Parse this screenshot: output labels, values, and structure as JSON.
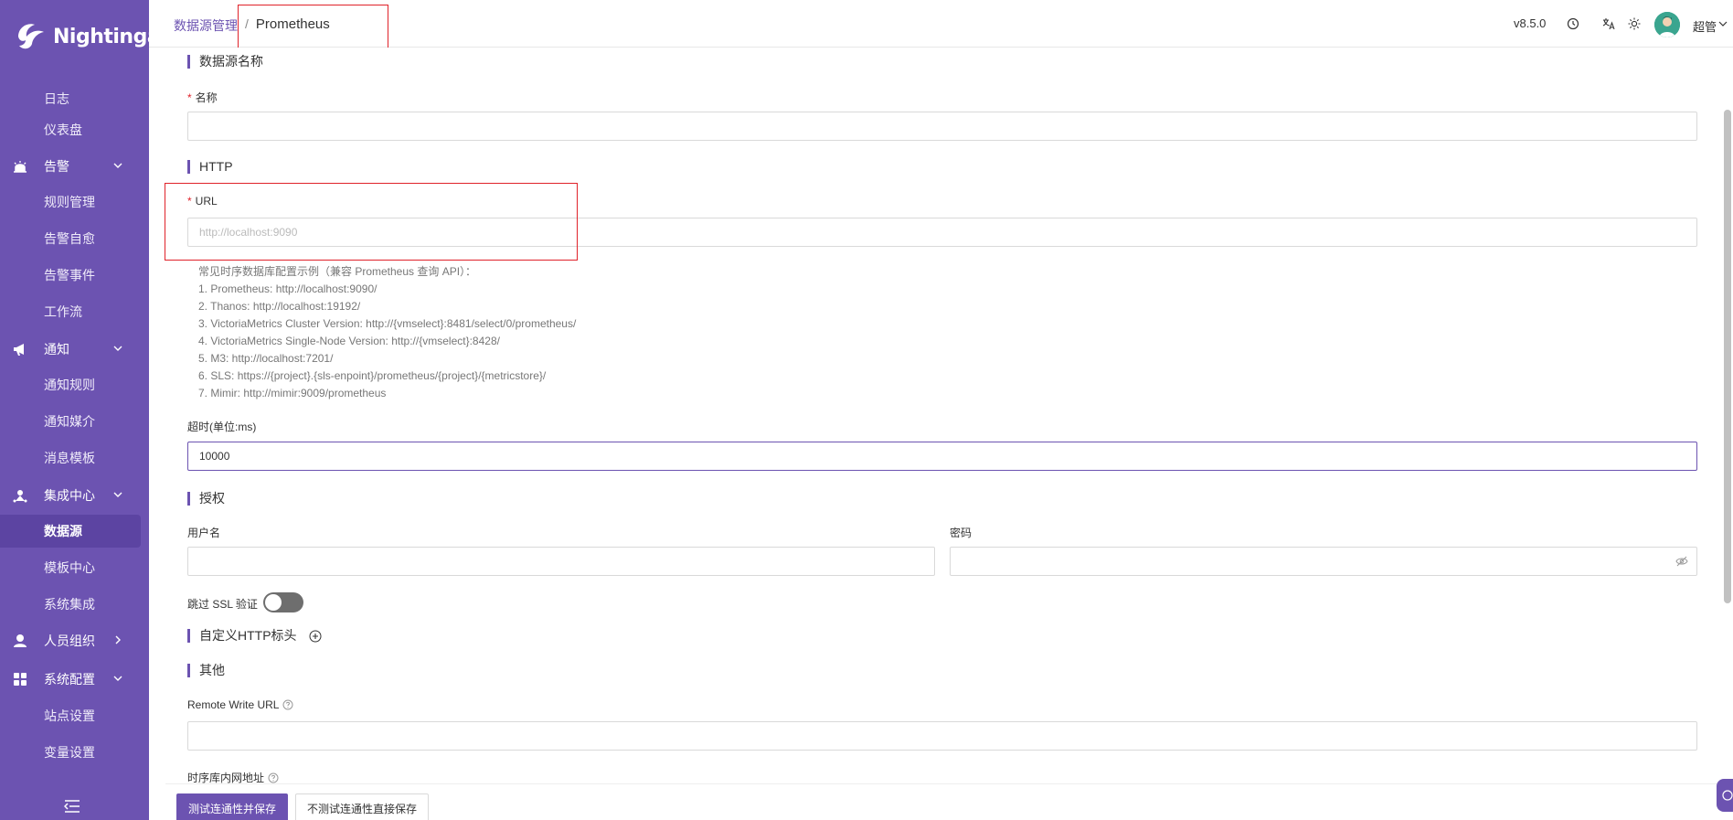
{
  "app": {
    "logo_text": "Nightingale"
  },
  "sidebar": {
    "items": [
      {
        "label": "日志",
        "type": "sub"
      },
      {
        "label": "仪表盘",
        "type": "sub"
      },
      {
        "label": "告警",
        "type": "group",
        "icon": "alarm-icon",
        "chevron": "down"
      },
      {
        "label": "规则管理",
        "type": "sub"
      },
      {
        "label": "告警自愈",
        "type": "sub"
      },
      {
        "label": "告警事件",
        "type": "sub"
      },
      {
        "label": "工作流",
        "type": "sub"
      },
      {
        "label": "通知",
        "type": "group",
        "icon": "megaphone-icon",
        "chevron": "down"
      },
      {
        "label": "通知规则",
        "type": "sub"
      },
      {
        "label": "通知媒介",
        "type": "sub"
      },
      {
        "label": "消息模板",
        "type": "sub"
      },
      {
        "label": "集成中心",
        "type": "group",
        "icon": "integration-icon",
        "chevron": "down"
      },
      {
        "label": "数据源",
        "type": "sub",
        "active": true
      },
      {
        "label": "模板中心",
        "type": "sub"
      },
      {
        "label": "系统集成",
        "type": "sub"
      },
      {
        "label": "人员组织",
        "type": "group",
        "icon": "user-icon",
        "chevron": "right"
      },
      {
        "label": "系统配置",
        "type": "group",
        "icon": "grid-icon",
        "chevron": "down"
      },
      {
        "label": "站点设置",
        "type": "sub"
      },
      {
        "label": "变量设置",
        "type": "sub"
      }
    ]
  },
  "header": {
    "breadcrumb_parent": "数据源管理",
    "breadcrumb_sep": "/",
    "breadcrumb_current": "Prometheus",
    "version": "v8.5.0",
    "username": "超管"
  },
  "form": {
    "section_name": "数据源名称",
    "name_label": "名称",
    "name_value": "",
    "section_http": "HTTP",
    "url_label": "URL",
    "url_placeholder": "http://localhost:9090",
    "help_lines": [
      "常见时序数据库配置示例（兼容 Prometheus 查询 API）：",
      "1. Prometheus: http://localhost:9090/",
      "2. Thanos: http://localhost:19192/",
      "3. VictoriaMetrics Cluster Version: http://{vmselect}:8481/select/0/prometheus/",
      "4. VictoriaMetrics Single-Node Version: http://{vmselect}:8428/",
      "5. M3: http://localhost:7201/",
      "6. SLS: https://{project}.{sls-enpoint}/prometheus/{project}/{metricstore}/",
      "7. Mimir: http://mimir:9009/prometheus"
    ],
    "timeout_label": "超时(单位:ms)",
    "timeout_value": "10000",
    "section_auth": "授权",
    "username_label": "用户名",
    "password_label": "密码",
    "skip_ssl_label": "跳过 SSL 验证",
    "skip_ssl_enabled": false,
    "section_headers": "自定义HTTP标头",
    "section_other": "其他",
    "remote_write_label": "Remote Write URL",
    "internal_addr_label": "时序库内网地址"
  },
  "footer": {
    "test_save_label": "测试连通性并保存",
    "save_direct_label": "不测试连通性直接保存"
  },
  "colors": {
    "brand": "#6c53b1",
    "highlight": "#e0222a"
  }
}
